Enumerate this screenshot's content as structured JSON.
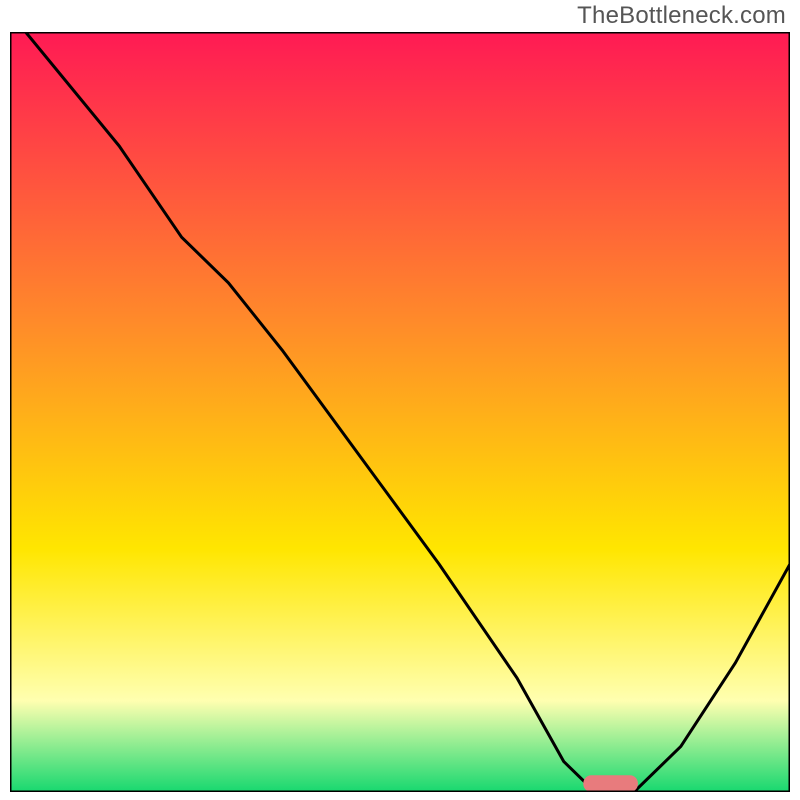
{
  "watermark": "TheBottleneck.com",
  "chart_data": {
    "type": "line",
    "title": "",
    "xlabel": "",
    "ylabel": "",
    "xlim": [
      0,
      100
    ],
    "ylim": [
      0,
      100
    ],
    "gradient_bg": {
      "top": "#ff1a54",
      "upper_mid": "#ff8a2a",
      "mid": "#ffe600",
      "lower": "#ffffb0",
      "bottom": "#17d86f"
    },
    "series": [
      {
        "name": "bottleneck-curve",
        "color": "#000000",
        "x": [
          2,
          14,
          22,
          28,
          35,
          45,
          55,
          65,
          71,
          75,
          80,
          86,
          93,
          100
        ],
        "y": [
          100,
          85,
          73,
          67,
          58,
          44,
          30,
          15,
          4,
          0,
          0,
          6,
          17,
          30
        ]
      }
    ],
    "marker": {
      "name": "optimal-marker",
      "color": "#e87b7d",
      "x_center": 77,
      "y": 0,
      "width": 7,
      "height": 2.2
    }
  }
}
